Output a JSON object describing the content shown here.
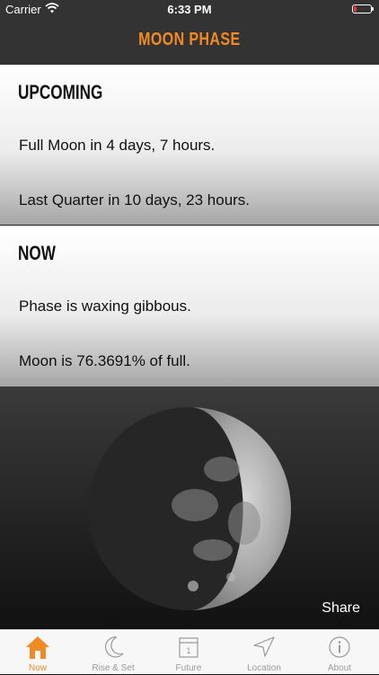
{
  "status_bar": {
    "carrier": "Carrier",
    "time": "6:33 PM"
  },
  "nav": {
    "title": "MOON PHASE"
  },
  "upcoming": {
    "heading": "UPCOMING",
    "lines": [
      "Full Moon in 4 days, 7 hours.",
      "Last Quarter in 10 days, 23 hours."
    ]
  },
  "now": {
    "heading": "NOW",
    "lines": [
      "Phase is waxing gibbous.",
      "Moon is 76.3691% of full."
    ]
  },
  "moon": {
    "illumination_fraction": 0.763691,
    "phase": "waxing gibbous"
  },
  "share_label": "Share",
  "tabs": [
    {
      "label": "Now",
      "icon": "home-icon",
      "active": true
    },
    {
      "label": "Rise & Set",
      "icon": "crescent-moon-icon",
      "active": false
    },
    {
      "label": "Future",
      "icon": "calendar-icon",
      "active": false
    },
    {
      "label": "Location",
      "icon": "location-arrow-icon",
      "active": false
    },
    {
      "label": "About",
      "icon": "info-icon",
      "active": false
    }
  ],
  "colors": {
    "accent": "#f08a24",
    "nav_background": "#333333",
    "tab_inactive": "#9a9a9a",
    "battery_low": "#e53935"
  }
}
